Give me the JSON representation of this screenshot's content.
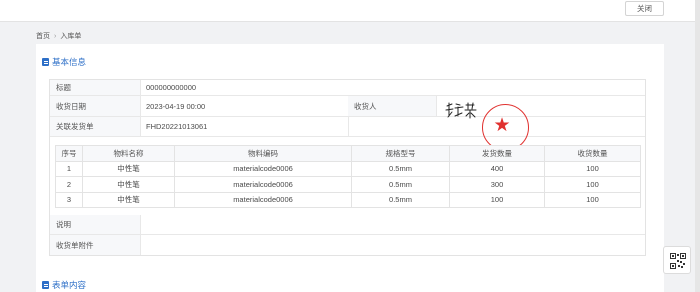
{
  "topbar": {
    "close_label": "关闭"
  },
  "breadcrumb": {
    "home": "首页",
    "sep": "›",
    "current": "入库单"
  },
  "sections": {
    "basic_info": "基本信息",
    "form_content": "表单内容"
  },
  "info": {
    "title_label": "标题",
    "title_value": "000000000000",
    "date_label": "收货日期",
    "date_value": "2023-04-19 00:00",
    "receiver_label": "收货人",
    "shipment_label": "关联发货单",
    "shipment_value": "FHD20221013061",
    "note_label": "说明",
    "note_value": "",
    "attachment_label": "收货单附件"
  },
  "table": {
    "headers": [
      "序号",
      "物料名称",
      "物料编码",
      "规格型号",
      "发货数量",
      "收货数量"
    ],
    "rows": [
      [
        "1",
        "中性笔",
        "materialcode0006",
        "0.5mm",
        "400",
        "100"
      ],
      [
        "2",
        "中性笔",
        "materialcode0006",
        "0.5mm",
        "300",
        "100"
      ],
      [
        "3",
        "中性笔",
        "materialcode0006",
        "0.5mm",
        "100",
        "100"
      ]
    ]
  },
  "icons": {
    "stamp": "red-seal-star",
    "qr": "qr-code-icon",
    "section": "document-icon"
  },
  "colors": {
    "accent": "#2d6fc7",
    "stamp": "#e0312f"
  }
}
